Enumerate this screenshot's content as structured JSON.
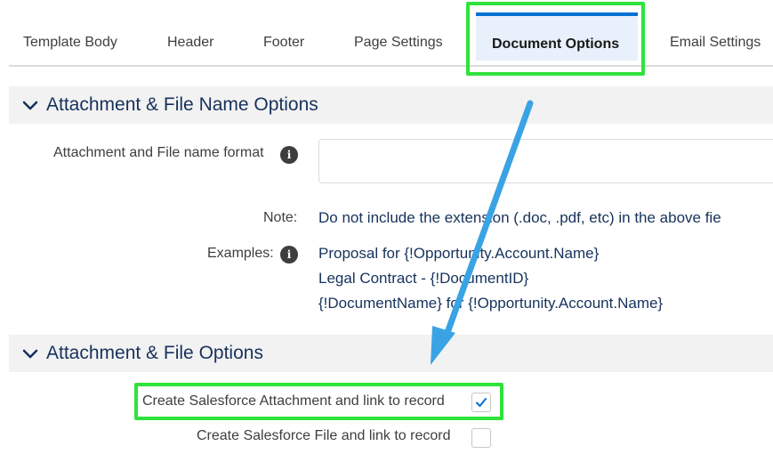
{
  "tabs": [
    {
      "label": "Template Body"
    },
    {
      "label": "Header"
    },
    {
      "label": "Footer"
    },
    {
      "label": "Page Settings"
    },
    {
      "label": "Document Options",
      "active": true
    },
    {
      "label": "Email Settings"
    }
  ],
  "sections": {
    "name_options": {
      "title": "Attachment & File Name Options"
    },
    "file_options": {
      "title": "Attachment & File Options"
    }
  },
  "name_format": {
    "label": "Attachment and File name format",
    "value": "",
    "placeholder": ""
  },
  "note": {
    "label": "Note:",
    "text": "Do not include the extension (.doc, .pdf, etc) in the above fie"
  },
  "examples": {
    "label": "Examples:",
    "lines": [
      "Proposal for {!Opportunity.Account.Name}",
      "Legal Contract - {!DocumentID}",
      "{!DocumentName} for {!Opportunity.Account.Name}"
    ]
  },
  "options": {
    "attachment": {
      "label": "Create Salesforce Attachment and link to record",
      "checked": true
    },
    "file": {
      "label": "Create Salesforce File and link to record",
      "checked": false
    }
  },
  "icons": {
    "chevron": "chevron-down-icon",
    "info": "info-icon",
    "check": "check-icon"
  },
  "colors": {
    "highlight": "#2ee33b",
    "accent": "#0070d2",
    "arrow": "#3aa3e3",
    "section_title": "#16325c"
  }
}
